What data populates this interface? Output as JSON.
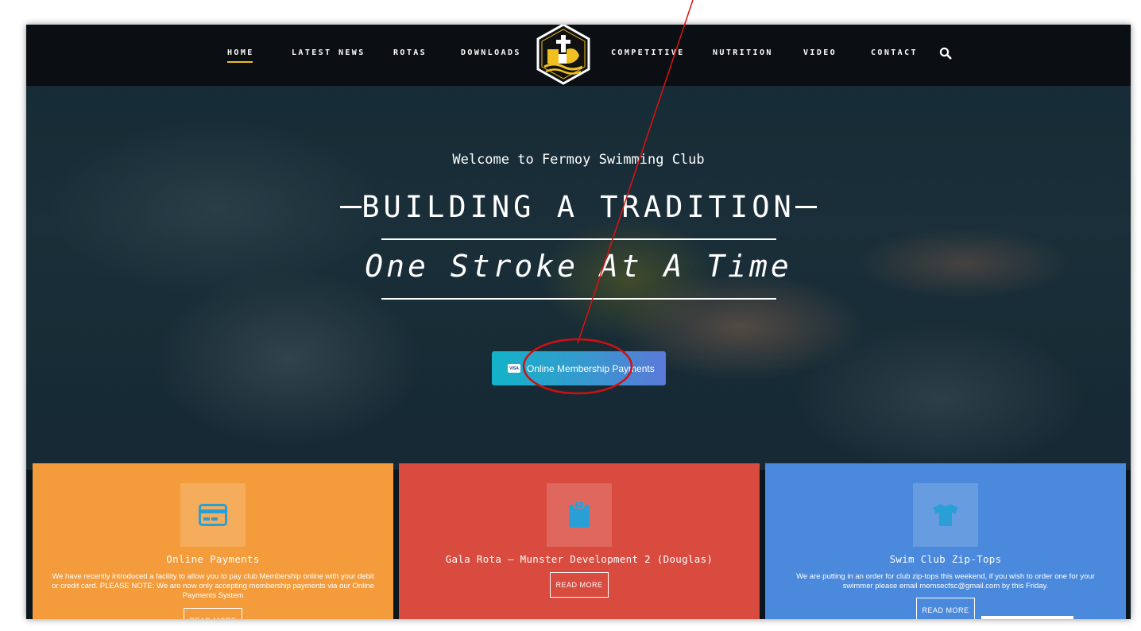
{
  "nav": {
    "items": [
      {
        "label": "HOME",
        "active": true
      },
      {
        "label": "LATEST NEWS"
      },
      {
        "label": "ROTAS"
      },
      {
        "label": "DOWNLOADS"
      },
      {
        "label": "COMPETITIVE"
      },
      {
        "label": "NUTRITION"
      },
      {
        "label": "VIDEO"
      },
      {
        "label": "CONTACT"
      }
    ],
    "search_icon": "search-icon",
    "active_color": "#f0c020"
  },
  "hero": {
    "welcome": "Welcome to Fermoy Swimming Club",
    "headline": "BUILDING A TRADITION",
    "tagline": "One Stroke At A Time",
    "cta_label": "Online Membership Payments",
    "cta_icon": "visa-card-icon",
    "cta_icon_text": "VISA"
  },
  "cards": [
    {
      "title": "Online Payments",
      "icon": "credit-card-icon",
      "text": "We have recently introduced a facility to allow you to pay club Membership online with your debit or credit card. PLEASE NOTE: We are now only accepting membership payments via our Online Payments System",
      "button": "READ MORE",
      "color": "#f49c3c"
    },
    {
      "title": "Gala Rota – Munster Development 2 (Douglas)",
      "icon": "clipboard-icon",
      "text": "",
      "button": "READ MORE",
      "color": "#d94a3f"
    },
    {
      "title": "Swim Club Zip-Tops",
      "icon": "tshirt-icon",
      "text": "We are putting in an order for club zip-tops this weekend, if you wish to order one for your swimmer please email memsecfsc@gmail.com by this Friday.",
      "button": "READ MORE",
      "color": "#4a89dc"
    }
  ],
  "annotation": {
    "color": "#e01010"
  }
}
